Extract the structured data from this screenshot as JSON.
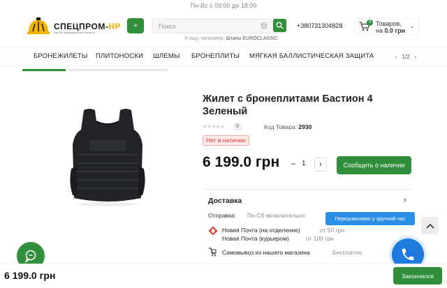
{
  "topbar": {
    "hours": "Пн-Вс с 09:00 до 18:00"
  },
  "header": {
    "logo_text_main": "СПЕЦПРОМ-",
    "logo_text_accent": "НР",
    "logo_subtitle": "засоби індивідуального захисту",
    "menu_icon": "+",
    "search_placeholder": "Поиск",
    "search_hint_prefix": "Я ищу, например:",
    "search_hint_example": "Штаны EUROCLASSIC",
    "phone": "+380731304828",
    "cart_count": "0",
    "cart_line1": "Товаров,",
    "cart_line2_prefix": "на",
    "cart_total": "0.0 грн",
    "cart_chevron": "⌄"
  },
  "nav": {
    "items": [
      "БРОНЕЖИЛЕТЫ",
      "ПЛИТОНОСКИ",
      "ШЛЕМЫ",
      "БРОНЕПЛИТЫ",
      "МЯГКАЯ БАЛЛИСТИЧЕСКАЯ ЗАЩИТА"
    ],
    "pager_prev": "‹",
    "pager_label": "1/2",
    "pager_next": "›"
  },
  "product": {
    "title": "Жилет с бронеплитами Бастион 4 Зеленый",
    "stars": "★★★★★",
    "review_count": "0",
    "code_label": "Код Товара:",
    "code_value": "2930",
    "stock_status": "Нет в наличии",
    "price": "6 199.0 грн",
    "qty_minus": "−",
    "qty_value": "1",
    "qty_plus": "›",
    "notify_button": "Сообщить о наличии"
  },
  "delivery": {
    "title": "Доставка",
    "chevron": "›",
    "ship_label": "Отправка:",
    "ship_value": "Пн-Сб включительно",
    "np_branch": "Новая Почта (на отделение)",
    "np_branch_price": "от 50 грн",
    "np_courier": "Новая Почта (курьером)",
    "np_courier_price": "от 100 грн",
    "pickup": "Самовывоз из нашего магазина",
    "pickup_price": "Бесплатно"
  },
  "floating": {
    "callback_tooltip": "Передзвонимо у зручний час"
  },
  "bottom_bar": {
    "price": "6 199.0 грн",
    "button": "Закончился"
  },
  "colors": {
    "brand_green": "#2f8f3a",
    "accent_yellow": "#f0b400",
    "call_blue": "#1f7ae0",
    "stock_red": "#d33333"
  }
}
